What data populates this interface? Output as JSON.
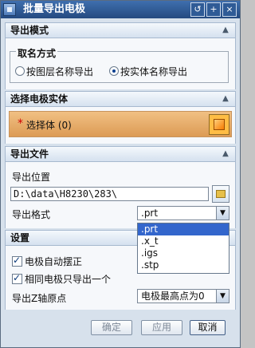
{
  "window": {
    "title": "批量导出电极",
    "buttons": [
      "↺",
      "+",
      "×"
    ]
  },
  "sections": {
    "export_mode": {
      "title": "导出模式",
      "group_title": "取名方式",
      "options": [
        "按图层名称导出",
        "按实体名称导出"
      ],
      "selected": "按实体名称导出"
    },
    "select_solid": {
      "title": "选择电极实体",
      "selector_label": "选择体 (0)"
    },
    "export_file": {
      "title": "导出文件",
      "location_label": "导出位置",
      "location_value": "D:\\data\\H8230\\283\\",
      "format_label": "导出格式",
      "format_value": ".prt",
      "format_options": [
        ".prt",
        ".x_t",
        ".igs",
        ".stp"
      ]
    },
    "settings": {
      "title": "设置",
      "checkboxes": [
        "电极自动摆正",
        "相同电极只导出一个"
      ],
      "z_origin_label": "导出Z轴原点",
      "z_origin_value": "电极最高点为0"
    }
  },
  "footer": {
    "ok": "确定",
    "apply": "应用",
    "cancel": "取消"
  },
  "colors": {
    "titlebar": "#2f5b96",
    "selector": "#e7ab6a",
    "selected_option": "#3366cc"
  }
}
